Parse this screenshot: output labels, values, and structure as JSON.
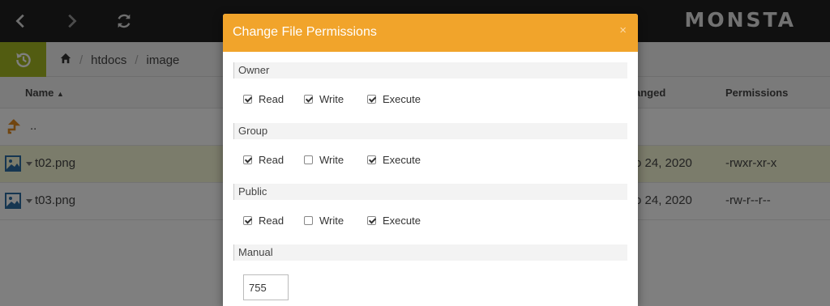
{
  "app": {
    "logo_text": "MONSTA"
  },
  "toolbar": {
    "back_icon": "chevron-left-icon",
    "forward_icon": "chevron-right-icon",
    "refresh_icon": "refresh-icon"
  },
  "breadcrumb": {
    "home_icon": "home-icon",
    "items": [
      "htdocs",
      "image"
    ],
    "separator": "/"
  },
  "table": {
    "columns": {
      "name": "Name",
      "changed": "anged",
      "permissions": "Permissions"
    },
    "parent_row": "..",
    "rows": [
      {
        "name": "t02.png",
        "changed": "o 24, 2020",
        "permissions": "-rwxr-xr-x",
        "selected": true
      },
      {
        "name": "t03.png",
        "changed": "o 24, 2020",
        "permissions": "-rw-r--r--",
        "selected": false
      }
    ]
  },
  "modal": {
    "title": "Change File Permissions",
    "close": "×",
    "sections": [
      {
        "label": "Owner",
        "read": true,
        "write": true,
        "execute": true
      },
      {
        "label": "Group",
        "read": true,
        "write": false,
        "execute": true
      },
      {
        "label": "Public",
        "read": true,
        "write": false,
        "execute": true
      }
    ],
    "perm_labels": {
      "read": "Read",
      "write": "Write",
      "execute": "Execute"
    },
    "manual_label": "Manual",
    "manual_value": "755"
  },
  "colors": {
    "header_bg": "#f1a42b",
    "history_btn": "#a5b822",
    "selected_row": "#f7f9d6",
    "topbar": "#202020"
  }
}
